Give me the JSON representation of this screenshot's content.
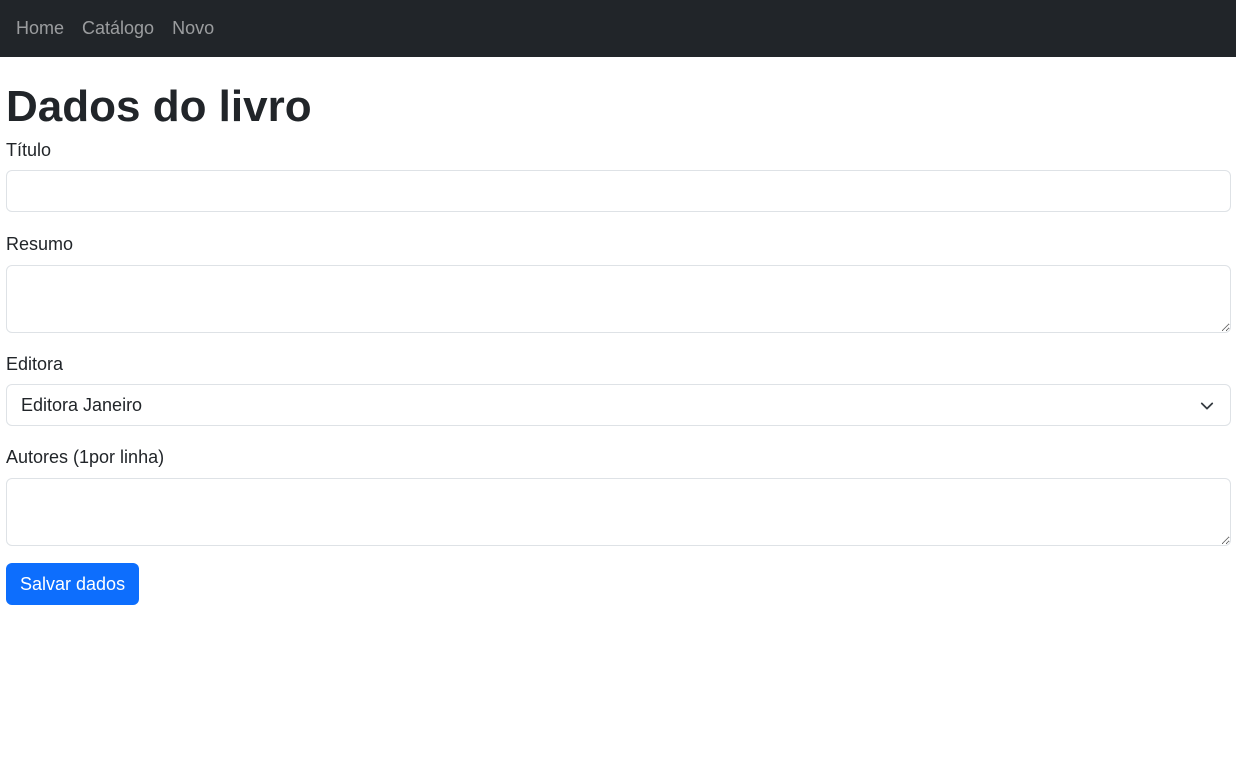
{
  "nav": {
    "items": [
      {
        "label": "Home"
      },
      {
        "label": "Catálogo"
      },
      {
        "label": "Novo"
      }
    ]
  },
  "page": {
    "title": "Dados do livro"
  },
  "form": {
    "titulo_label": "Título",
    "titulo_value": "",
    "resumo_label": "Resumo",
    "resumo_value": "",
    "editora_label": "Editora",
    "editora_selected": "Editora Janeiro",
    "autores_label": "Autores (1por linha)",
    "autores_value": "",
    "submit_label": "Salvar dados"
  },
  "colors": {
    "navbar_bg": "#212529",
    "primary": "#0d6efd",
    "border": "#dee2e6"
  },
  "icons": {
    "select_arrow": "chevron-down-icon",
    "resize_handle": "resize-grip-icon"
  }
}
